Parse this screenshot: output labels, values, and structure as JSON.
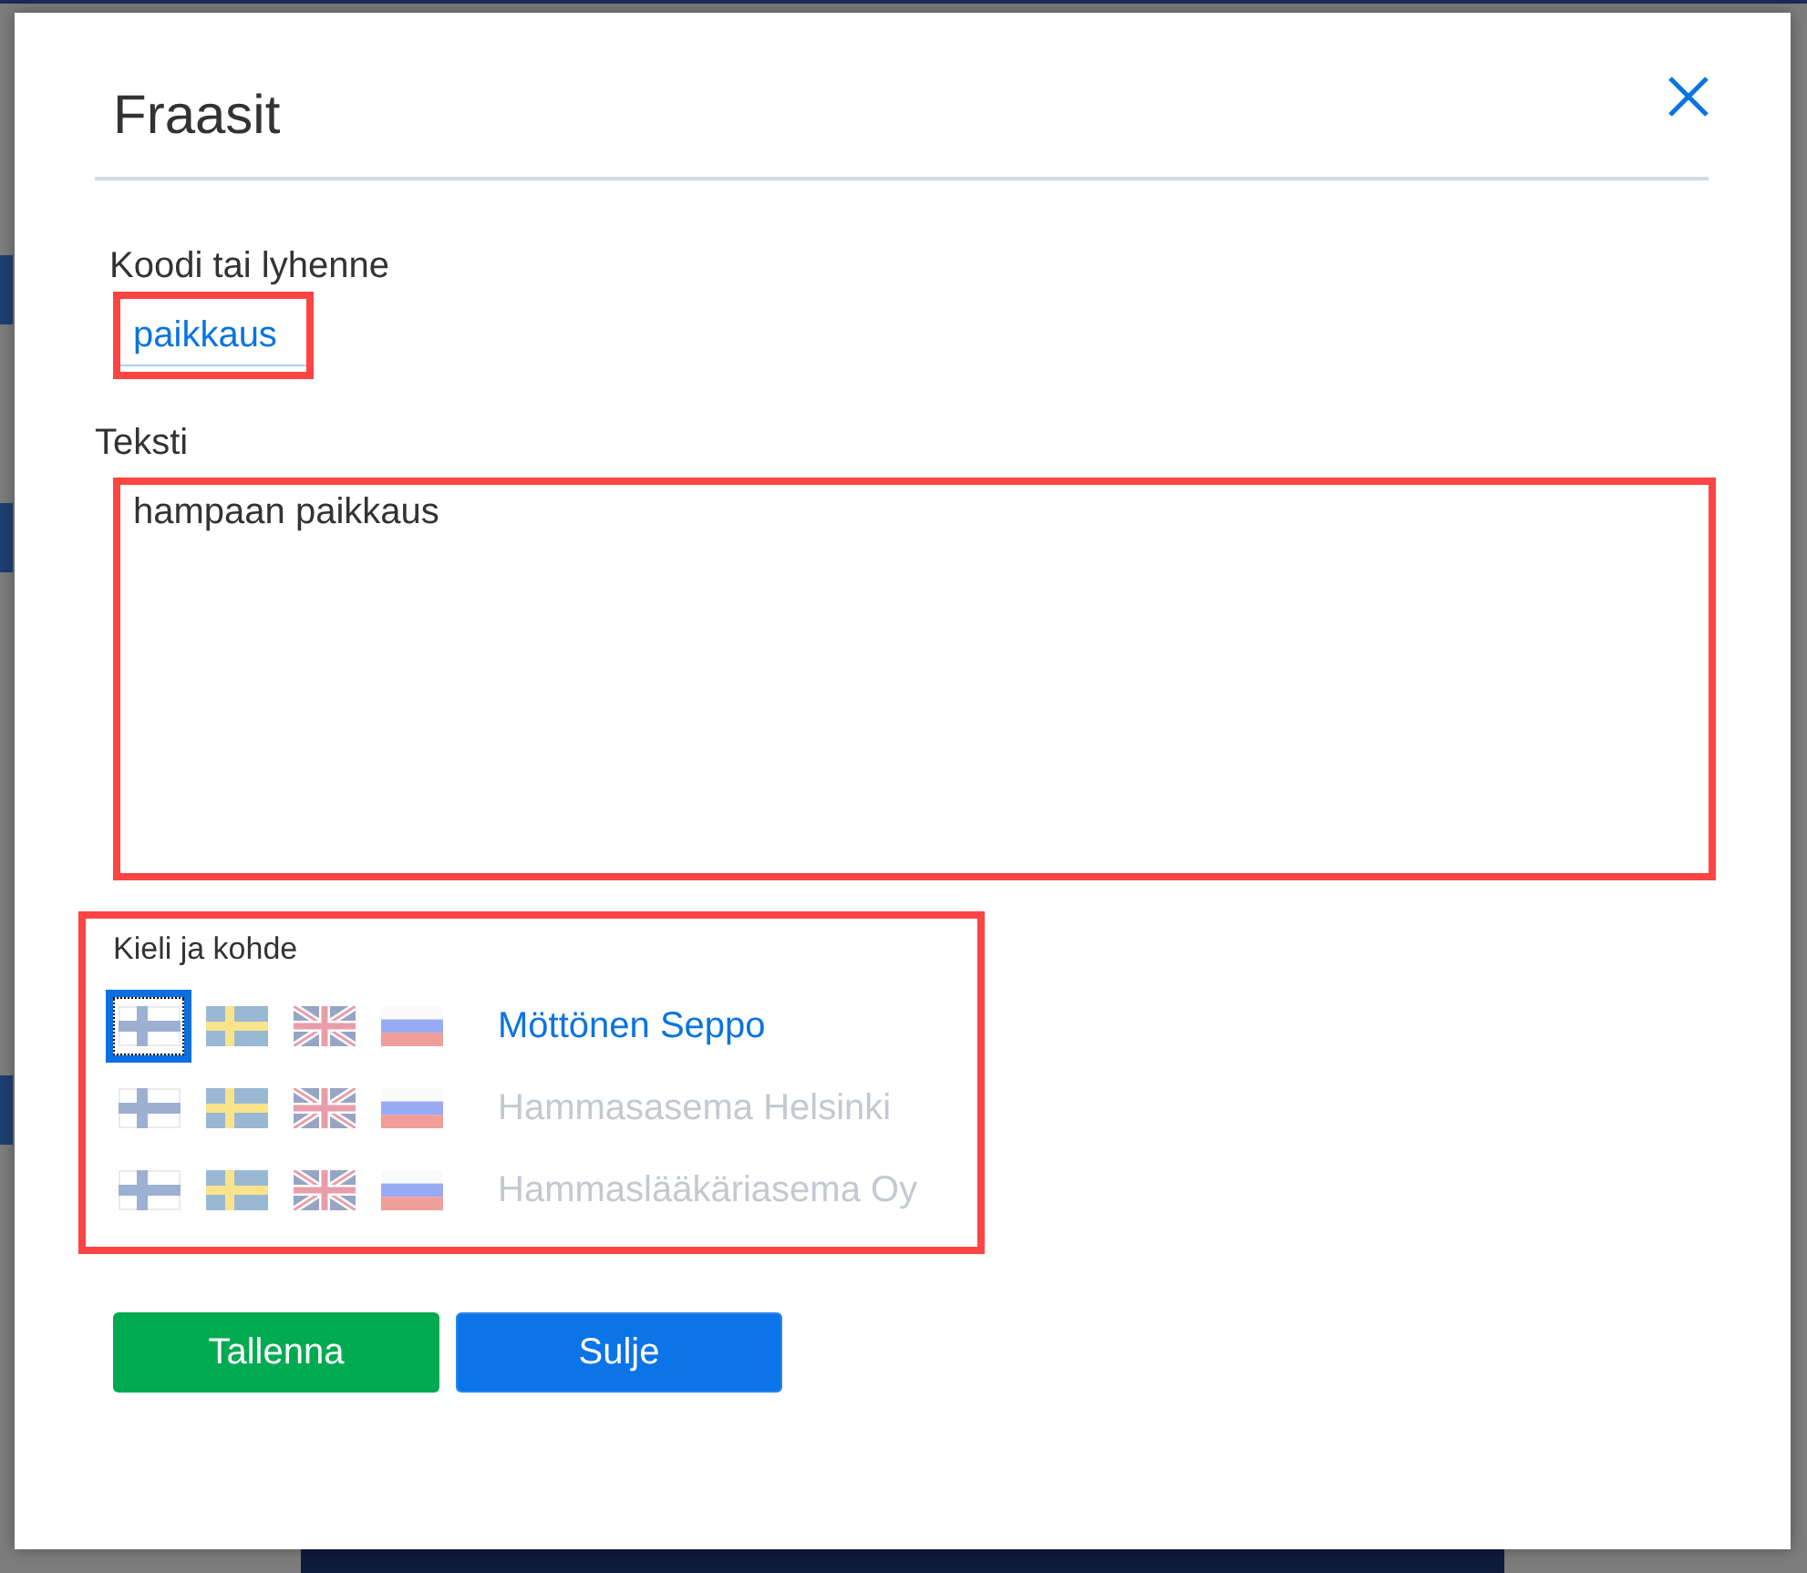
{
  "dialog": {
    "title": "Fraasit"
  },
  "code_field": {
    "label": "Koodi tai lyhenne",
    "value": "paikkaus",
    "highlighted": true
  },
  "text_field": {
    "label": "Teksti",
    "value": "hampaan paikkaus",
    "highlighted": true
  },
  "language_section": {
    "label": "Kieli ja kohde",
    "highlighted": true,
    "rows": [
      {
        "name": "Möttönen Seppo",
        "selected": true,
        "flags": [
          {
            "selected": true
          },
          {
            "selected": false
          },
          {
            "selected": false
          },
          {
            "selected": false
          }
        ]
      },
      {
        "name": "Hammasasema Helsinki",
        "selected": false,
        "flags": [
          {
            "selected": false
          },
          {
            "selected": false
          },
          {
            "selected": false
          },
          {
            "selected": false
          }
        ]
      },
      {
        "name": "Hammaslääkäriasema Oy",
        "selected": false,
        "flags": [
          {
            "selected": false
          },
          {
            "selected": false
          },
          {
            "selected": false
          },
          {
            "selected": false
          }
        ]
      }
    ]
  },
  "buttons": [
    {
      "label": "Tallenna",
      "kind": "save"
    },
    {
      "label": "Sulje",
      "kind": "close"
    }
  ]
}
